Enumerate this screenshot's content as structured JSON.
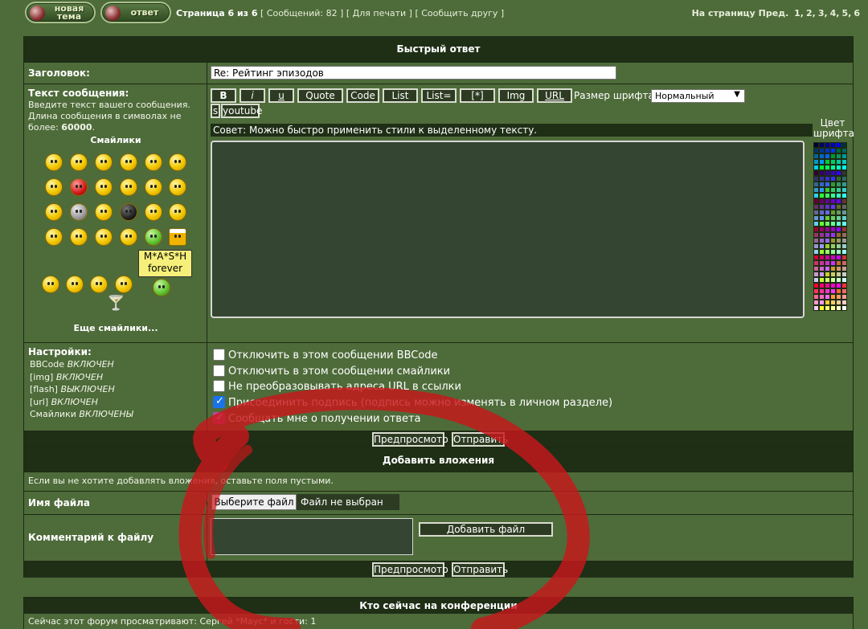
{
  "top": {
    "new_topic": "новая тема",
    "reply": "ответ",
    "page_info": "Страница 6 из 6",
    "messages": "[ Сообщений: 82 ]",
    "print": "[ Для печати ]",
    "tell_friend": "[ Сообщить другу ]",
    "pages_label": "На страницу Пред.",
    "pages": [
      "1,",
      "2,",
      "3,",
      "4,",
      "5,",
      "6"
    ]
  },
  "quick_reply": {
    "header": "Быстрый ответ",
    "subject_label": "Заголовок:",
    "subject_value": "Re: Рейтинг эпизодов",
    "body_label": "Текст сообщения:",
    "body_hint": "Введите текст вашего сообщения. Длина сообщения в символах не более:",
    "body_limit": "60000",
    "smilies_title": "Смайлики",
    "more_smilies": "Еще смайлики...",
    "mash_line1": "M*A*S*H",
    "mash_line2": "forever",
    "format_buttons": [
      "B",
      "i",
      "u",
      "Quote",
      "Code",
      "List",
      "List=",
      "[*]",
      "Img",
      "URL"
    ],
    "font_size_label": "Размер шрифта:",
    "font_size_value": "Нормальный",
    "s_button": "s",
    "youtube_button": "youtube",
    "tip": "Совет: Можно быстро применить стили к выделенному тексту.",
    "font_color_label": "Цвет шрифта"
  },
  "settings": {
    "label": "Настройки:",
    "bbcode_name": "BBCode",
    "bbcode_state": "ВКЛЮЧЕН",
    "img_name": "[img]",
    "img_state": "ВКЛЮЧЕН",
    "flash_name": "[flash]",
    "flash_state": "ВЫКЛЮЧЕН",
    "url_name": "[url]",
    "url_state": "ВКЛЮЧЕН",
    "smilies_name": "Смайлики",
    "smilies_state": "ВКЛЮЧЕНЫ",
    "options": [
      {
        "label": "Отключить в этом сообщении BBCode",
        "checked": false
      },
      {
        "label": "Отключить в этом сообщении смайлики",
        "checked": false
      },
      {
        "label": "Не преобразовывать адреса URL в ссылки",
        "checked": false
      },
      {
        "label": "Присоединить подпись (подпись можно изменять в личном разделе)",
        "checked": true
      },
      {
        "label": "Сообщать мне о получении ответа",
        "checked": true
      }
    ],
    "preview": "Предпросмотр",
    "submit": "Отправить"
  },
  "attachments": {
    "header": "Добавить вложения",
    "note": "Если вы не хотите добавлять вложения, оставьте поля пустыми.",
    "filename_label": "Имя файла",
    "choose_file": "Выберите файл",
    "no_file": "Файл не выбран",
    "comment_label": "Комментарий к файлу",
    "add_file": "Добавить файл",
    "preview": "Предпросмотр",
    "submit": "Отправить"
  },
  "online": {
    "header": "Кто сейчас на конференции",
    "text": "Сейчас этот форум просматривают: Сергей *Маус* и гости: 1"
  },
  "colors": {
    "background": "#4e6b3a",
    "header": "#1f2f16",
    "scribble": "#c8171b"
  }
}
